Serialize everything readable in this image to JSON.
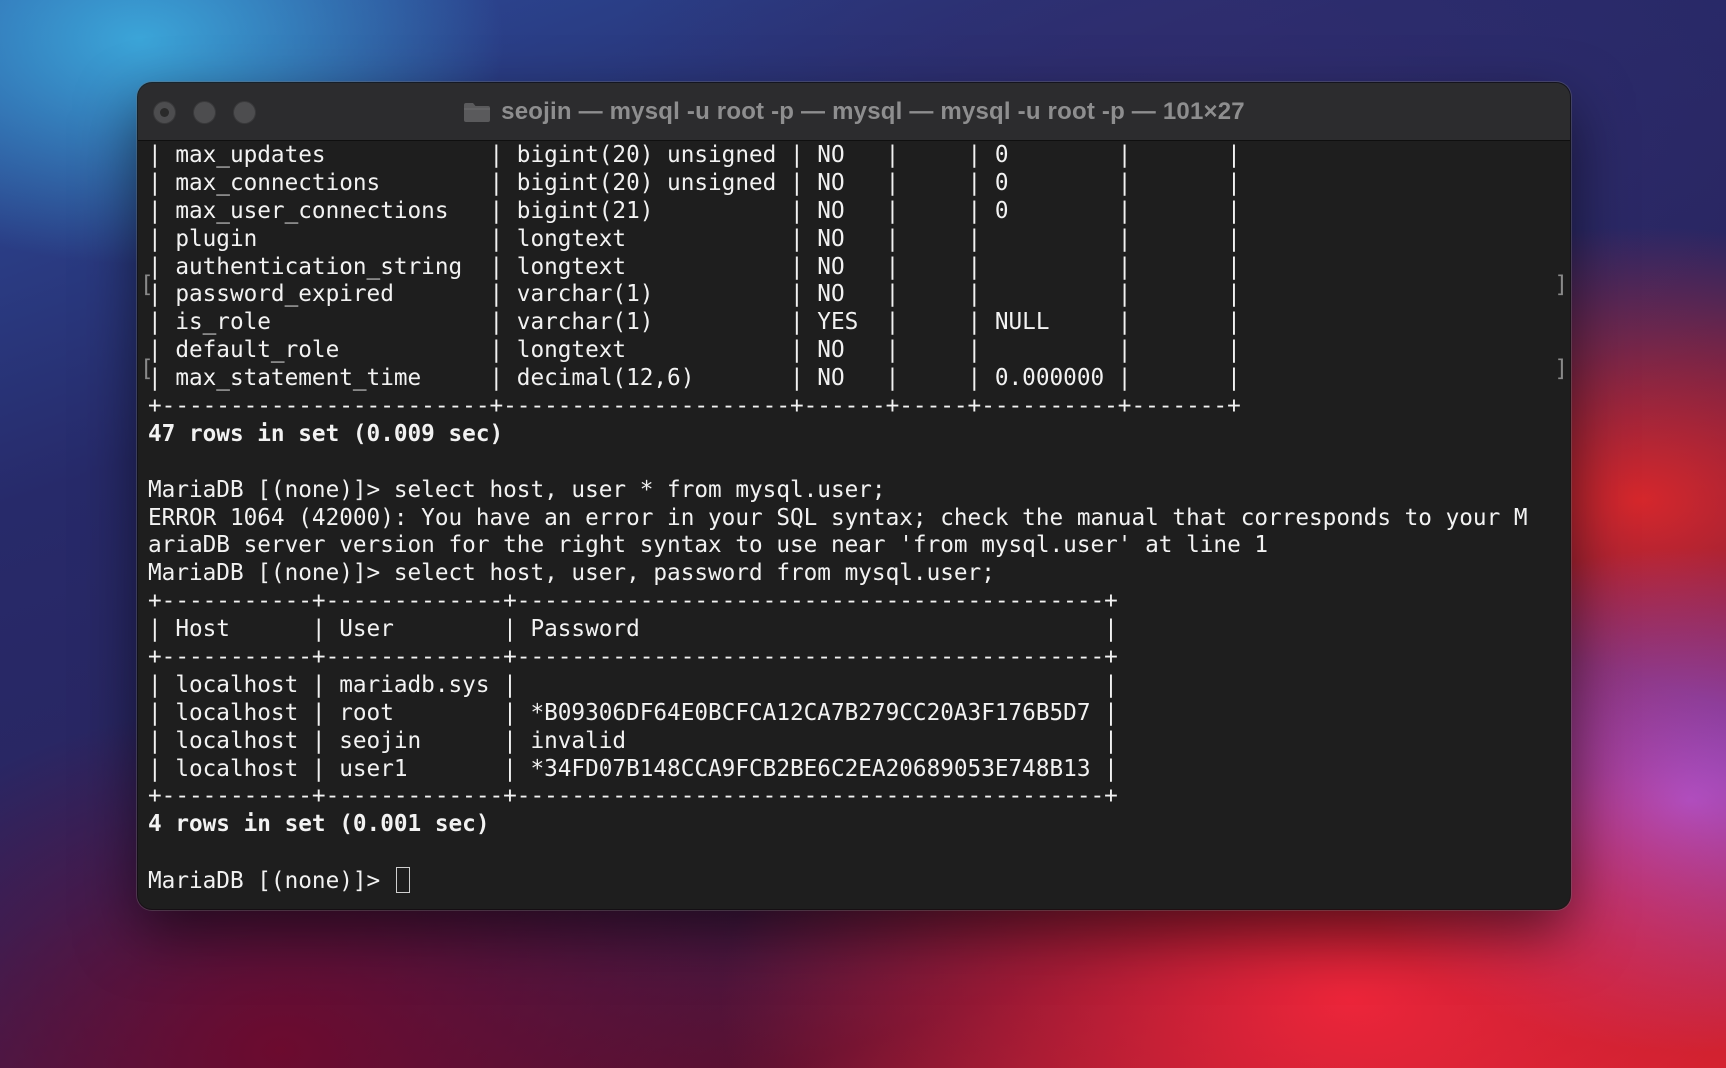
{
  "window": {
    "title": "seojin — mysql -u root -p — mysql — mysql -u root -p — 101×27"
  },
  "terminal": {
    "lines": [
      "| max_updates            | bigint(20) unsigned | NO   |     | 0        |       |",
      "| max_connections        | bigint(20) unsigned | NO   |     | 0        |       |",
      "| max_user_connections   | bigint(21)          | NO   |     | 0        |       |",
      "| plugin                 | longtext            | NO   |     |          |       |",
      "| authentication_string  | longtext            | NO   |     |          |       |",
      "| password_expired       | varchar(1)          | NO   |     |          |       |",
      "| is_role                | varchar(1)          | YES  |     | NULL     |       |",
      "| default_role           | longtext            | NO   |     |          |       |",
      "| max_statement_time     | decimal(12,6)       | NO   |     | 0.000000 |       |",
      "+------------------------+---------------------+------+-----+----------+-------+",
      "47 rows in set (0.009 sec)",
      "",
      "MariaDB [(none)]> select host, user * from mysql.user;",
      "ERROR 1064 (42000): You have an error in your SQL syntax; check the manual that corresponds to your M",
      "ariaDB server version for the right syntax to use near 'from mysql.user' at line 1",
      "MariaDB [(none)]> select host, user, password from mysql.user;",
      "+-----------+-------------+-------------------------------------------+",
      "| Host      | User        | Password                                  |",
      "+-----------+-------------+-------------------------------------------+",
      "| localhost | mariadb.sys |                                           |",
      "| localhost | root        | *B09306DF64E0BCFCA12CA7B279CC20A3F176B5D7 |",
      "| localhost | seojin      | invalid                                   |",
      "| localhost | user1       | *34FD07B148CCA9FCB2BE6C2EA20689053E748B13 |",
      "+-----------+-------------+-------------------------------------------+",
      "4 rows in set (0.001 sec)",
      "",
      "MariaDB [(none)]> "
    ],
    "bracket_left": "[",
    "bracket_right": "]"
  },
  "colors": {
    "terminal_bg": "#1e1e1e",
    "titlebar_bg": "#2c2c2e",
    "text": "#f2f2f2",
    "title_text": "#8e8e8f"
  },
  "icons": {
    "folder": "folder-icon"
  }
}
